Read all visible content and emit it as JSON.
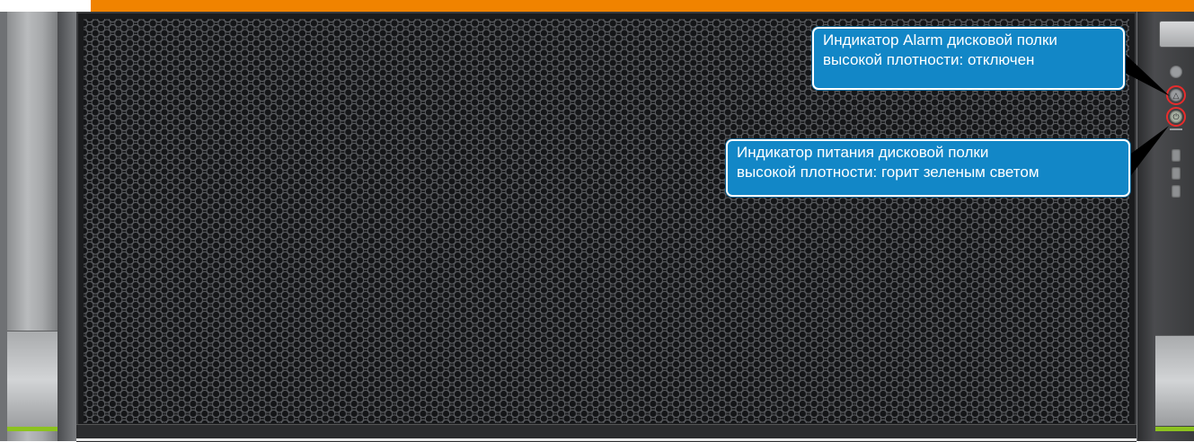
{
  "callouts": {
    "alarm": {
      "line1": "Индикатор Alarm дисковой полки",
      "line2": "высокой плотности: отключен"
    },
    "power": {
      "line1": "Индикатор питания дисковой полки",
      "line2": "высокой плотности: горит зеленым светом"
    }
  },
  "indicators": {
    "alarm_state": "off",
    "power_state": "green"
  },
  "colors": {
    "callout_fill": "#1287c7",
    "highlight_ring": "#e82c2c",
    "top_strip": "#f08300",
    "accent_green": "#8cc21f"
  }
}
